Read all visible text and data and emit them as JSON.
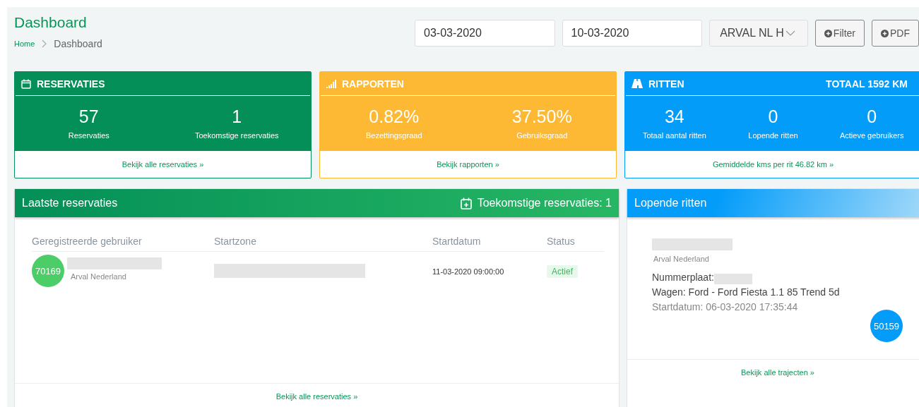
{
  "page_title": "Dashboard",
  "breadcrumb": [
    {
      "label": "Home",
      "current": false
    },
    {
      "label": "Dashboard",
      "current": true
    }
  ],
  "filters": {
    "start_date": "03-03-2020",
    "end_date": "10-03-2020",
    "company": "ARVAL NL H",
    "buttons": [
      "Filter",
      "PDF"
    ]
  },
  "stat_cards": [
    {
      "kind": "calendar",
      "title": "RESERVATIES",
      "color": "#038f57",
      "stats": [
        {
          "value": "57",
          "label": "Reservaties"
        },
        {
          "value": "1",
          "label": "Toekomstige reservaties"
        }
      ],
      "link": "Bekijk alle reservaties »"
    },
    {
      "kind": "signal",
      "title": "RAPPORTEN",
      "color": "#fdb933",
      "stats": [
        {
          "value": "0.82%",
          "label": "Bezettingsgraad"
        },
        {
          "value": "37.50%",
          "label": "Gebruiksgraad"
        }
      ],
      "link": "Bekijk rapporten »"
    },
    {
      "kind": "road",
      "title": "RITTEN",
      "total": "TOTAAL 1592 KM",
      "color": "#039cf9",
      "stats": [
        {
          "value": "34",
          "label": "Totaal aantal ritten"
        },
        {
          "value": "0",
          "label": "Lopende ritten"
        },
        {
          "value": "0",
          "label": "Actieve gebruikers"
        }
      ],
      "link": "Gemiddelde kms per rit 46.82 km »"
    }
  ],
  "latest_reservations": {
    "title": "Laatste reservaties",
    "future_label": "Toekomstige reservaties: 1",
    "columns": [
      "Geregistreerde gebruiker",
      "Startzone",
      "Startdatum",
      "Status"
    ],
    "rows": [
      {
        "user_id": "70169",
        "company": "Arval Nederland",
        "start_date": "11-03-2020 09:00:00",
        "status": "Actief"
      }
    ],
    "link": "Bekijk alle reservaties »"
  },
  "running_trips": {
    "title": "Lopende ritten",
    "trips": [
      {
        "company": "Arval Nederland",
        "plate_label": "Nummerplaat:",
        "car": "Wagen: Ford - Ford Fiesta 1.1 85 Trend 5d",
        "start": "Startdatum: 06-03-2020 17:35:44",
        "id": "50159"
      }
    ],
    "link": "Bekijk alle trajecten »"
  }
}
